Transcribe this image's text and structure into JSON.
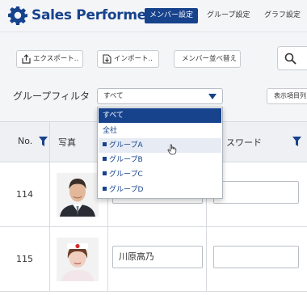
{
  "header": {
    "app_title": "Sales Performer",
    "tabs": [
      {
        "label": "メンバー設定",
        "active": true
      },
      {
        "label": "グループ設定",
        "active": false
      },
      {
        "label": "グラフ設定",
        "active": false
      }
    ]
  },
  "toolbar": {
    "export_label": "エクスポート..",
    "import_label": "インポート..",
    "sort_label": "メンバー並べ替え",
    "search_icon": "search-icon"
  },
  "filter": {
    "label": "グループフィルタ",
    "selected": "すべて",
    "display_items_label": "表示項目列",
    "options": [
      {
        "label": "すべて",
        "bullet": false,
        "state": "selected"
      },
      {
        "label": "全社",
        "bullet": false,
        "state": "normal"
      },
      {
        "label": "グループA",
        "bullet": true,
        "state": "hover"
      },
      {
        "label": "グループB",
        "bullet": true,
        "state": "normal"
      },
      {
        "label": "グループC",
        "bullet": true,
        "state": "normal"
      },
      {
        "label": "グループD",
        "bullet": true,
        "state": "normal"
      }
    ]
  },
  "table": {
    "columns": {
      "no": "No.",
      "photo": "写真",
      "password_fragment": "スワード"
    },
    "rows": [
      {
        "no": "114",
        "name": "",
        "password": ""
      },
      {
        "no": "115",
        "name": "川原高乃",
        "password": ""
      }
    ]
  },
  "colors": {
    "brand": "#17428c",
    "header_bg": "#f4f5f7",
    "table_header_bg": "#eef0f3",
    "hover_bg": "#e6ebf4"
  }
}
